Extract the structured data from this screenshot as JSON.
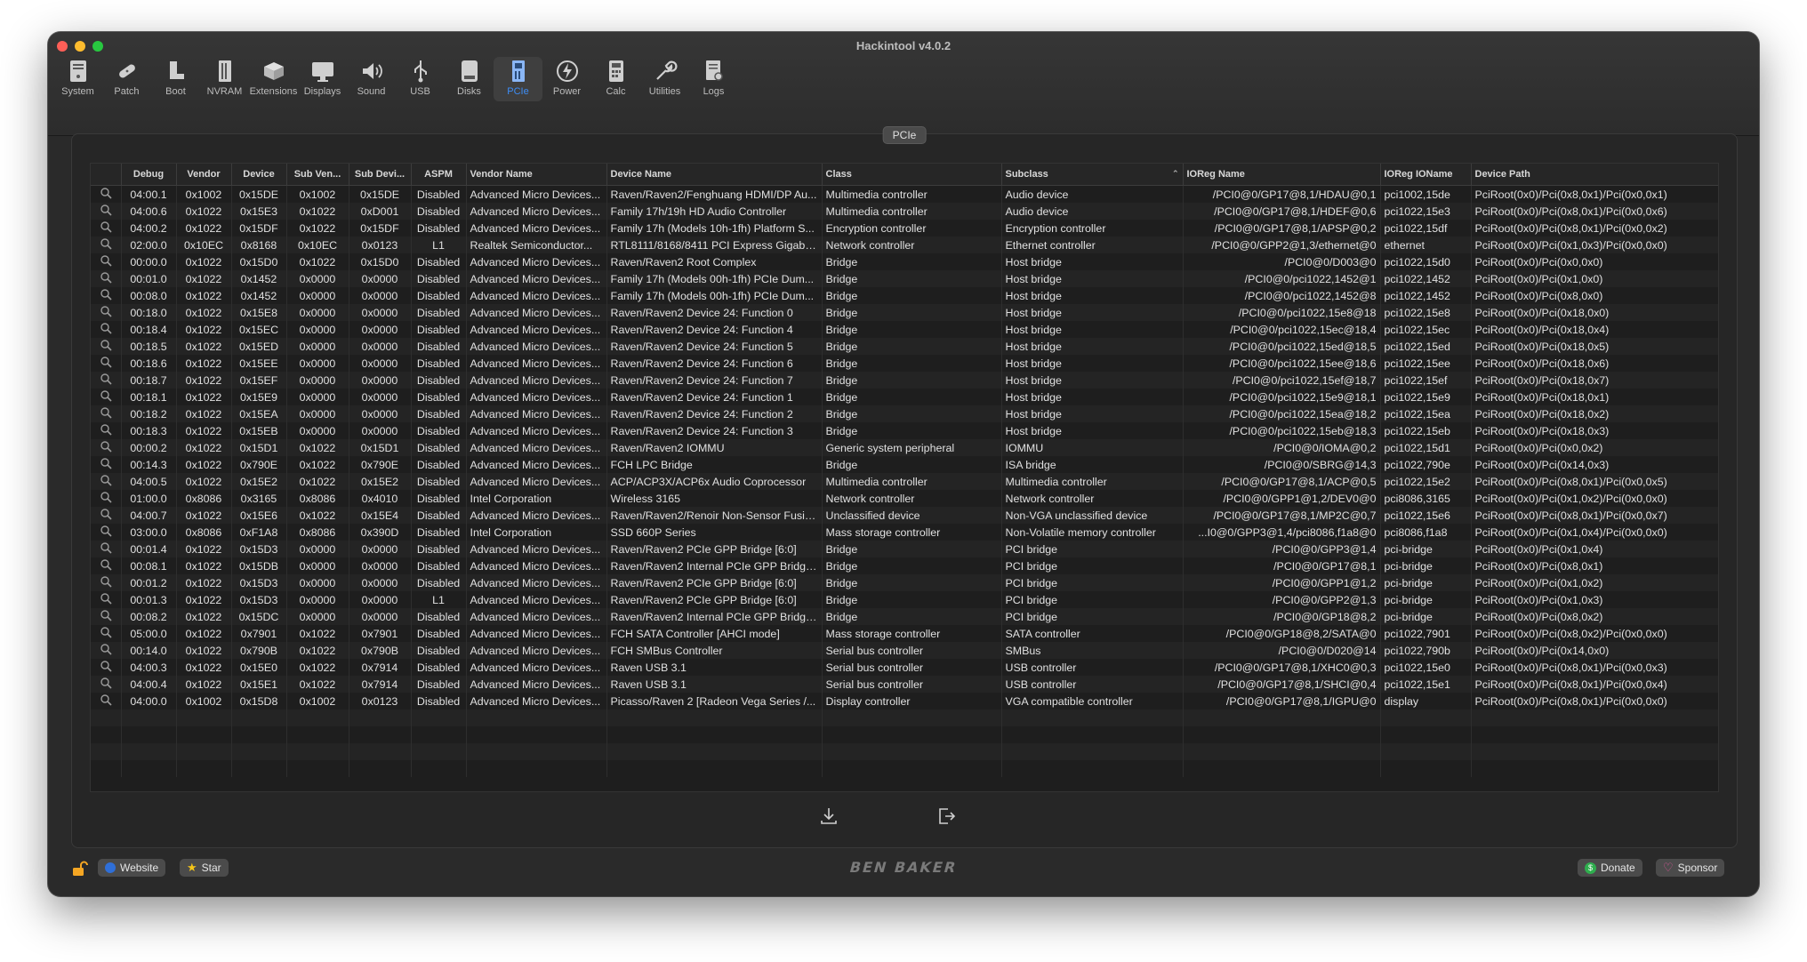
{
  "window": {
    "title": "Hackintool v4.0.2"
  },
  "toolbar": [
    {
      "label": "System",
      "icon": "system-icon"
    },
    {
      "label": "Patch",
      "icon": "patch-icon"
    },
    {
      "label": "Boot",
      "icon": "boot-icon"
    },
    {
      "label": "NVRAM",
      "icon": "nvram-icon"
    },
    {
      "label": "Extensions",
      "icon": "extensions-icon"
    },
    {
      "label": "Displays",
      "icon": "displays-icon"
    },
    {
      "label": "Sound",
      "icon": "sound-icon"
    },
    {
      "label": "USB",
      "icon": "usb-icon"
    },
    {
      "label": "Disks",
      "icon": "disks-icon"
    },
    {
      "label": "PCIe",
      "icon": "pcie-icon",
      "active": true
    },
    {
      "label": "Power",
      "icon": "power-icon"
    },
    {
      "label": "Calc",
      "icon": "calc-icon"
    },
    {
      "label": "Utilities",
      "icon": "utilities-icon"
    },
    {
      "label": "Logs",
      "icon": "logs-icon"
    }
  ],
  "panel": {
    "tab_label": "PCIe"
  },
  "table": {
    "columns": [
      "",
      "Debug",
      "Vendor",
      "Device",
      "Sub Ven...",
      "Sub Devi...",
      "ASPM",
      "Vendor Name",
      "Device Name",
      "Class",
      "Subclass",
      "IOReg Name",
      "IOReg IOName",
      "Device Path"
    ],
    "sorted_column": "Subclass",
    "rows": [
      [
        "04:00.1",
        "0x1002",
        "0x15DE",
        "0x1002",
        "0x15DE",
        "Disabled",
        "Advanced Micro Devices...",
        "Raven/Raven2/Fenghuang HDMI/DP Au...",
        "Multimedia controller",
        "Audio device",
        "/PCI0@0/GP17@8,1/HDAU@0,1",
        "pci1002,15de",
        "PciRoot(0x0)/Pci(0x8,0x1)/Pci(0x0,0x1)"
      ],
      [
        "04:00.6",
        "0x1022",
        "0x15E3",
        "0x1022",
        "0xD001",
        "Disabled",
        "Advanced Micro Devices...",
        "Family 17h/19h HD Audio Controller",
        "Multimedia controller",
        "Audio device",
        "/PCI0@0/GP17@8,1/HDEF@0,6",
        "pci1022,15e3",
        "PciRoot(0x0)/Pci(0x8,0x1)/Pci(0x0,0x6)"
      ],
      [
        "04:00.2",
        "0x1022",
        "0x15DF",
        "0x1022",
        "0x15DF",
        "Disabled",
        "Advanced Micro Devices...",
        "Family 17h (Models 10h-1fh) Platform S...",
        "Encryption controller",
        "Encryption controller",
        "/PCI0@0/GP17@8,1/APSP@0,2",
        "pci1022,15df",
        "PciRoot(0x0)/Pci(0x8,0x1)/Pci(0x0,0x2)"
      ],
      [
        "02:00.0",
        "0x10EC",
        "0x8168",
        "0x10EC",
        "0x0123",
        "L1",
        "Realtek Semiconductor...",
        "RTL8111/8168/8411 PCI Express Gigabit...",
        "Network controller",
        "Ethernet controller",
        "/PCI0@0/GPP2@1,3/ethernet@0",
        "ethernet",
        "PciRoot(0x0)/Pci(0x1,0x3)/Pci(0x0,0x0)"
      ],
      [
        "00:00.0",
        "0x1022",
        "0x15D0",
        "0x1022",
        "0x15D0",
        "Disabled",
        "Advanced Micro Devices...",
        "Raven/Raven2 Root Complex",
        "Bridge",
        "Host bridge",
        "/PCI0@0/D003@0",
        "pci1022,15d0",
        "PciRoot(0x0)/Pci(0x0,0x0)"
      ],
      [
        "00:01.0",
        "0x1022",
        "0x1452",
        "0x0000",
        "0x0000",
        "Disabled",
        "Advanced Micro Devices...",
        "Family 17h (Models 00h-1fh) PCIe Dum...",
        "Bridge",
        "Host bridge",
        "/PCI0@0/pci1022,1452@1",
        "pci1022,1452",
        "PciRoot(0x0)/Pci(0x1,0x0)"
      ],
      [
        "00:08.0",
        "0x1022",
        "0x1452",
        "0x0000",
        "0x0000",
        "Disabled",
        "Advanced Micro Devices...",
        "Family 17h (Models 00h-1fh) PCIe Dum...",
        "Bridge",
        "Host bridge",
        "/PCI0@0/pci1022,1452@8",
        "pci1022,1452",
        "PciRoot(0x0)/Pci(0x8,0x0)"
      ],
      [
        "00:18.0",
        "0x1022",
        "0x15E8",
        "0x0000",
        "0x0000",
        "Disabled",
        "Advanced Micro Devices...",
        "Raven/Raven2 Device 24: Function 0",
        "Bridge",
        "Host bridge",
        "/PCI0@0/pci1022,15e8@18",
        "pci1022,15e8",
        "PciRoot(0x0)/Pci(0x18,0x0)"
      ],
      [
        "00:18.4",
        "0x1022",
        "0x15EC",
        "0x0000",
        "0x0000",
        "Disabled",
        "Advanced Micro Devices...",
        "Raven/Raven2 Device 24: Function 4",
        "Bridge",
        "Host bridge",
        "/PCI0@0/pci1022,15ec@18,4",
        "pci1022,15ec",
        "PciRoot(0x0)/Pci(0x18,0x4)"
      ],
      [
        "00:18.5",
        "0x1022",
        "0x15ED",
        "0x0000",
        "0x0000",
        "Disabled",
        "Advanced Micro Devices...",
        "Raven/Raven2 Device 24: Function 5",
        "Bridge",
        "Host bridge",
        "/PCI0@0/pci1022,15ed@18,5",
        "pci1022,15ed",
        "PciRoot(0x0)/Pci(0x18,0x5)"
      ],
      [
        "00:18.6",
        "0x1022",
        "0x15EE",
        "0x0000",
        "0x0000",
        "Disabled",
        "Advanced Micro Devices...",
        "Raven/Raven2 Device 24: Function 6",
        "Bridge",
        "Host bridge",
        "/PCI0@0/pci1022,15ee@18,6",
        "pci1022,15ee",
        "PciRoot(0x0)/Pci(0x18,0x6)"
      ],
      [
        "00:18.7",
        "0x1022",
        "0x15EF",
        "0x0000",
        "0x0000",
        "Disabled",
        "Advanced Micro Devices...",
        "Raven/Raven2 Device 24: Function 7",
        "Bridge",
        "Host bridge",
        "/PCI0@0/pci1022,15ef@18,7",
        "pci1022,15ef",
        "PciRoot(0x0)/Pci(0x18,0x7)"
      ],
      [
        "00:18.1",
        "0x1022",
        "0x15E9",
        "0x0000",
        "0x0000",
        "Disabled",
        "Advanced Micro Devices...",
        "Raven/Raven2 Device 24: Function 1",
        "Bridge",
        "Host bridge",
        "/PCI0@0/pci1022,15e9@18,1",
        "pci1022,15e9",
        "PciRoot(0x0)/Pci(0x18,0x1)"
      ],
      [
        "00:18.2",
        "0x1022",
        "0x15EA",
        "0x0000",
        "0x0000",
        "Disabled",
        "Advanced Micro Devices...",
        "Raven/Raven2 Device 24: Function 2",
        "Bridge",
        "Host bridge",
        "/PCI0@0/pci1022,15ea@18,2",
        "pci1022,15ea",
        "PciRoot(0x0)/Pci(0x18,0x2)"
      ],
      [
        "00:18.3",
        "0x1022",
        "0x15EB",
        "0x0000",
        "0x0000",
        "Disabled",
        "Advanced Micro Devices...",
        "Raven/Raven2 Device 24: Function 3",
        "Bridge",
        "Host bridge",
        "/PCI0@0/pci1022,15eb@18,3",
        "pci1022,15eb",
        "PciRoot(0x0)/Pci(0x18,0x3)"
      ],
      [
        "00:00.2",
        "0x1022",
        "0x15D1",
        "0x1022",
        "0x15D1",
        "Disabled",
        "Advanced Micro Devices...",
        "Raven/Raven2 IOMMU",
        "Generic system peripheral",
        "IOMMU",
        "/PCI0@0/IOMA@0,2",
        "pci1022,15d1",
        "PciRoot(0x0)/Pci(0x0,0x2)"
      ],
      [
        "00:14.3",
        "0x1022",
        "0x790E",
        "0x1022",
        "0x790E",
        "Disabled",
        "Advanced Micro Devices...",
        "FCH LPC Bridge",
        "Bridge",
        "ISA bridge",
        "/PCI0@0/SBRG@14,3",
        "pci1022,790e",
        "PciRoot(0x0)/Pci(0x14,0x3)"
      ],
      [
        "04:00.5",
        "0x1022",
        "0x15E2",
        "0x1022",
        "0x15E2",
        "Disabled",
        "Advanced Micro Devices...",
        "ACP/ACP3X/ACP6x Audio Coprocessor",
        "Multimedia controller",
        "Multimedia controller",
        "/PCI0@0/GP17@8,1/ACP@0,5",
        "pci1022,15e2",
        "PciRoot(0x0)/Pci(0x8,0x1)/Pci(0x0,0x5)"
      ],
      [
        "01:00.0",
        "0x8086",
        "0x3165",
        "0x8086",
        "0x4010",
        "Disabled",
        "Intel Corporation",
        "Wireless 3165",
        "Network controller",
        "Network controller",
        "/PCI0@0/GPP1@1,2/DEV0@0",
        "pci8086,3165",
        "PciRoot(0x0)/Pci(0x1,0x2)/Pci(0x0,0x0)"
      ],
      [
        "04:00.7",
        "0x1022",
        "0x15E6",
        "0x1022",
        "0x15E4",
        "Disabled",
        "Advanced Micro Devices...",
        "Raven/Raven2/Renoir Non-Sensor Fusio...",
        "Unclassified device",
        "Non-VGA unclassified device",
        "/PCI0@0/GP17@8,1/MP2C@0,7",
        "pci1022,15e6",
        "PciRoot(0x0)/Pci(0x8,0x1)/Pci(0x0,0x7)"
      ],
      [
        "03:00.0",
        "0x8086",
        "0xF1A8",
        "0x8086",
        "0x390D",
        "Disabled",
        "Intel Corporation",
        "SSD 660P Series",
        "Mass storage controller",
        "Non-Volatile memory controller",
        "...I0@0/GPP3@1,4/pci8086,f1a8@0",
        "pci8086,f1a8",
        "PciRoot(0x0)/Pci(0x1,0x4)/Pci(0x0,0x0)"
      ],
      [
        "00:01.4",
        "0x1022",
        "0x15D3",
        "0x0000",
        "0x0000",
        "Disabled",
        "Advanced Micro Devices...",
        "Raven/Raven2 PCIe GPP Bridge [6:0]",
        "Bridge",
        "PCI bridge",
        "/PCI0@0/GPP3@1,4",
        "pci-bridge",
        "PciRoot(0x0)/Pci(0x1,0x4)"
      ],
      [
        "00:08.1",
        "0x1022",
        "0x15DB",
        "0x0000",
        "0x0000",
        "Disabled",
        "Advanced Micro Devices...",
        "Raven/Raven2 Internal PCIe GPP Bridge...",
        "Bridge",
        "PCI bridge",
        "/PCI0@0/GP17@8,1",
        "pci-bridge",
        "PciRoot(0x0)/Pci(0x8,0x1)"
      ],
      [
        "00:01.2",
        "0x1022",
        "0x15D3",
        "0x0000",
        "0x0000",
        "Disabled",
        "Advanced Micro Devices...",
        "Raven/Raven2 PCIe GPP Bridge [6:0]",
        "Bridge",
        "PCI bridge",
        "/PCI0@0/GPP1@1,2",
        "pci-bridge",
        "PciRoot(0x0)/Pci(0x1,0x2)"
      ],
      [
        "00:01.3",
        "0x1022",
        "0x15D3",
        "0x0000",
        "0x0000",
        "L1",
        "Advanced Micro Devices...",
        "Raven/Raven2 PCIe GPP Bridge [6:0]",
        "Bridge",
        "PCI bridge",
        "/PCI0@0/GPP2@1,3",
        "pci-bridge",
        "PciRoot(0x0)/Pci(0x1,0x3)"
      ],
      [
        "00:08.2",
        "0x1022",
        "0x15DC",
        "0x0000",
        "0x0000",
        "Disabled",
        "Advanced Micro Devices...",
        "Raven/Raven2 Internal PCIe GPP Bridge...",
        "Bridge",
        "PCI bridge",
        "/PCI0@0/GP18@8,2",
        "pci-bridge",
        "PciRoot(0x0)/Pci(0x8,0x2)"
      ],
      [
        "05:00.0",
        "0x1022",
        "0x7901",
        "0x1022",
        "0x7901",
        "Disabled",
        "Advanced Micro Devices...",
        "FCH SATA Controller [AHCI mode]",
        "Mass storage controller",
        "SATA controller",
        "/PCI0@0/GP18@8,2/SATA@0",
        "pci1022,7901",
        "PciRoot(0x0)/Pci(0x8,0x2)/Pci(0x0,0x0)"
      ],
      [
        "00:14.0",
        "0x1022",
        "0x790B",
        "0x1022",
        "0x790B",
        "Disabled",
        "Advanced Micro Devices...",
        "FCH SMBus Controller",
        "Serial bus controller",
        "SMBus",
        "/PCI0@0/D020@14",
        "pci1022,790b",
        "PciRoot(0x0)/Pci(0x14,0x0)"
      ],
      [
        "04:00.3",
        "0x1022",
        "0x15E0",
        "0x1022",
        "0x7914",
        "Disabled",
        "Advanced Micro Devices...",
        "Raven USB 3.1",
        "Serial bus controller",
        "USB controller",
        "/PCI0@0/GP17@8,1/XHC0@0,3",
        "pci1022,15e0",
        "PciRoot(0x0)/Pci(0x8,0x1)/Pci(0x0,0x3)"
      ],
      [
        "04:00.4",
        "0x1022",
        "0x15E1",
        "0x1022",
        "0x7914",
        "Disabled",
        "Advanced Micro Devices...",
        "Raven USB 3.1",
        "Serial bus controller",
        "USB controller",
        "/PCI0@0/GP17@8,1/SHCI@0,4",
        "pci1022,15e1",
        "PciRoot(0x0)/Pci(0x8,0x1)/Pci(0x0,0x4)"
      ],
      [
        "04:00.0",
        "0x1002",
        "0x15D8",
        "0x1002",
        "0x0123",
        "Disabled",
        "Advanced Micro Devices...",
        "Picasso/Raven 2 [Radeon Vega Series /...",
        "Display controller",
        "VGA compatible controller",
        "/PCI0@0/GP17@8,1/IGPU@0",
        "display",
        "PciRoot(0x0)/Pci(0x8,0x1)/Pci(0x0,0x0)"
      ]
    ]
  },
  "bottom": {
    "website_label": "Website",
    "star_label": "Star",
    "brand_text": "BEN BAKER",
    "donate_label": "Donate",
    "sponsor_label": "Sponsor"
  },
  "colors": {
    "accent": "#3d8ef7",
    "window_bg": "#2a2a2a",
    "table_bg": "#1e1e1e"
  }
}
